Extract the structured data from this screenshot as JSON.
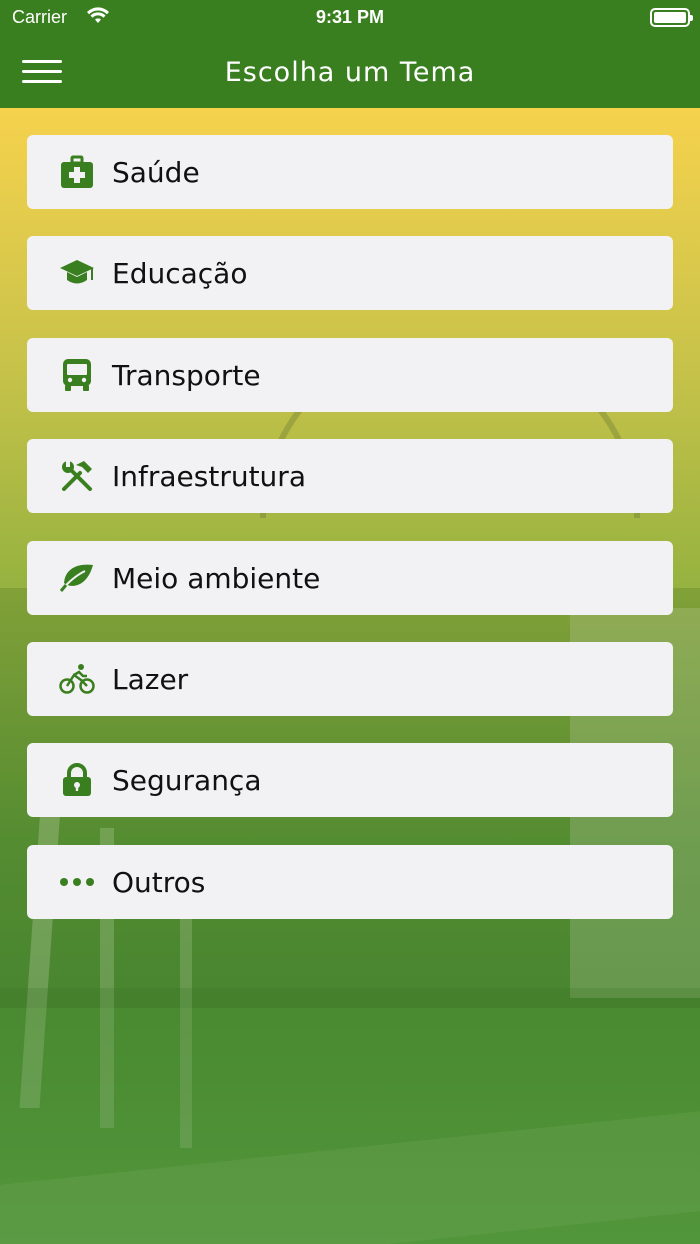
{
  "status_bar": {
    "carrier": "Carrier",
    "time": "9:31 PM",
    "battery_level_percent": 100
  },
  "nav": {
    "title": "Escolha um Tema",
    "menu_icon": "hamburger-menu-icon"
  },
  "colors": {
    "nav_background": "#3a7f1f",
    "icon_green": "#3a7f1f",
    "card_background": "#f2f2f4",
    "gradient_top": "#f6d24d",
    "gradient_bottom": "#4f9134"
  },
  "topics": [
    {
      "label": "Saúde",
      "icon": "first-aid-kit-icon"
    },
    {
      "label": "Educação",
      "icon": "graduation-cap-icon"
    },
    {
      "label": "Transporte",
      "icon": "bus-icon"
    },
    {
      "label": "Infraestrutura",
      "icon": "hammer-wrench-tools-icon"
    },
    {
      "label": "Meio ambiente",
      "icon": "leaf-icon"
    },
    {
      "label": "Lazer",
      "icon": "bicycle-icon"
    },
    {
      "label": "Segurança",
      "icon": "lock-icon"
    },
    {
      "label": "Outros",
      "icon": "ellipsis-icon"
    }
  ]
}
